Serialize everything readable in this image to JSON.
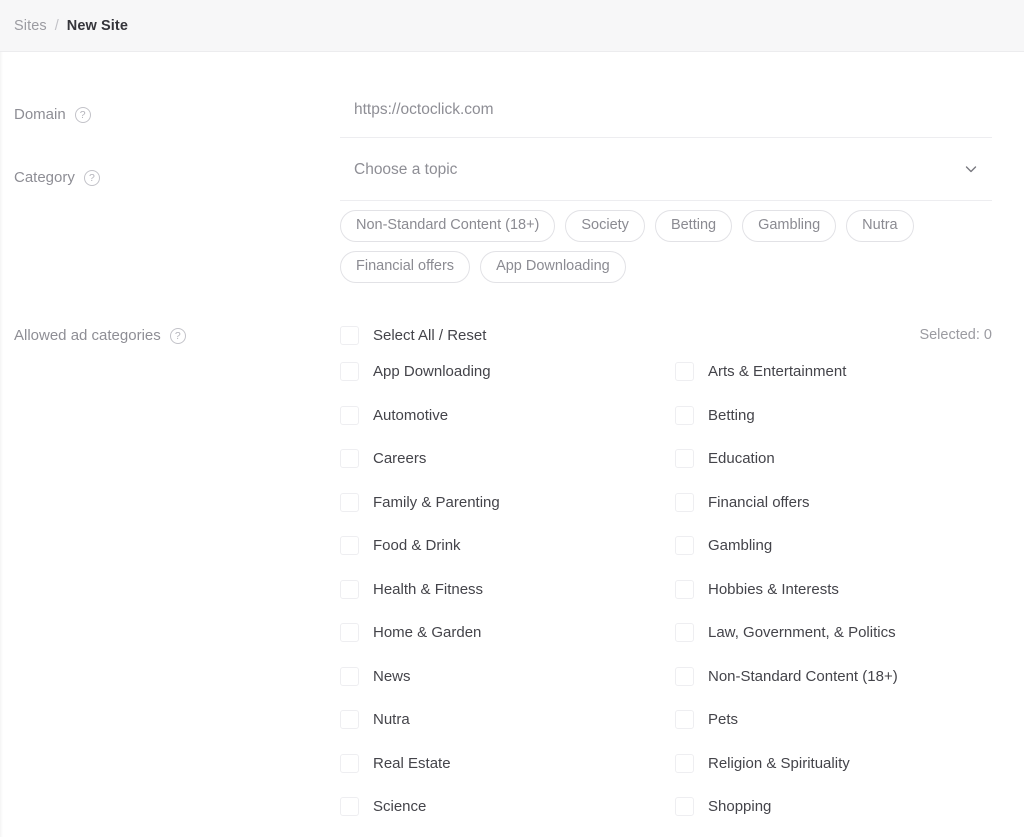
{
  "breadcrumb": {
    "parent": "Sites",
    "separator": "/",
    "current": "New Site"
  },
  "form": {
    "domain": {
      "label": "Domain",
      "help_icon": "question-circle-icon",
      "value": "",
      "placeholder": "https://octoclick.com"
    },
    "category": {
      "label": "Category",
      "help_icon": "question-circle-icon",
      "selected": "Choose a topic",
      "chevron_icon": "chevron-down-icon",
      "suggestions": [
        "Non-Standard Content (18+)",
        "Society",
        "Betting",
        "Gambling",
        "Nutra",
        "Financial offers",
        "App Downloading"
      ]
    },
    "allowed_ad_categories": {
      "label": "Allowed ad categories",
      "help_icon": "question-circle-icon",
      "select_all_label": "Select All / Reset",
      "selected_text": "Selected: 0",
      "selected_count": 0,
      "columns": {
        "left": [
          "App Downloading",
          "Automotive",
          "Careers",
          "Family & Parenting",
          "Food & Drink",
          "Health & Fitness",
          "Home & Garden",
          "News",
          "Nutra",
          "Real Estate",
          "Science"
        ],
        "right": [
          "Arts & Entertainment",
          "Betting",
          "Education",
          "Financial offers",
          "Gambling",
          "Hobbies & Interests",
          "Law, Government, & Politics",
          "Non-Standard Content (18+)",
          "Pets",
          "Religion & Spirituality",
          "Shopping"
        ]
      }
    }
  },
  "colors": {
    "topbar_bg": "#f7f7f8",
    "text_dark": "#35353b",
    "text_muted": "#8e8e95",
    "border": "#ededf0",
    "pill_border": "#e2e2e6"
  }
}
